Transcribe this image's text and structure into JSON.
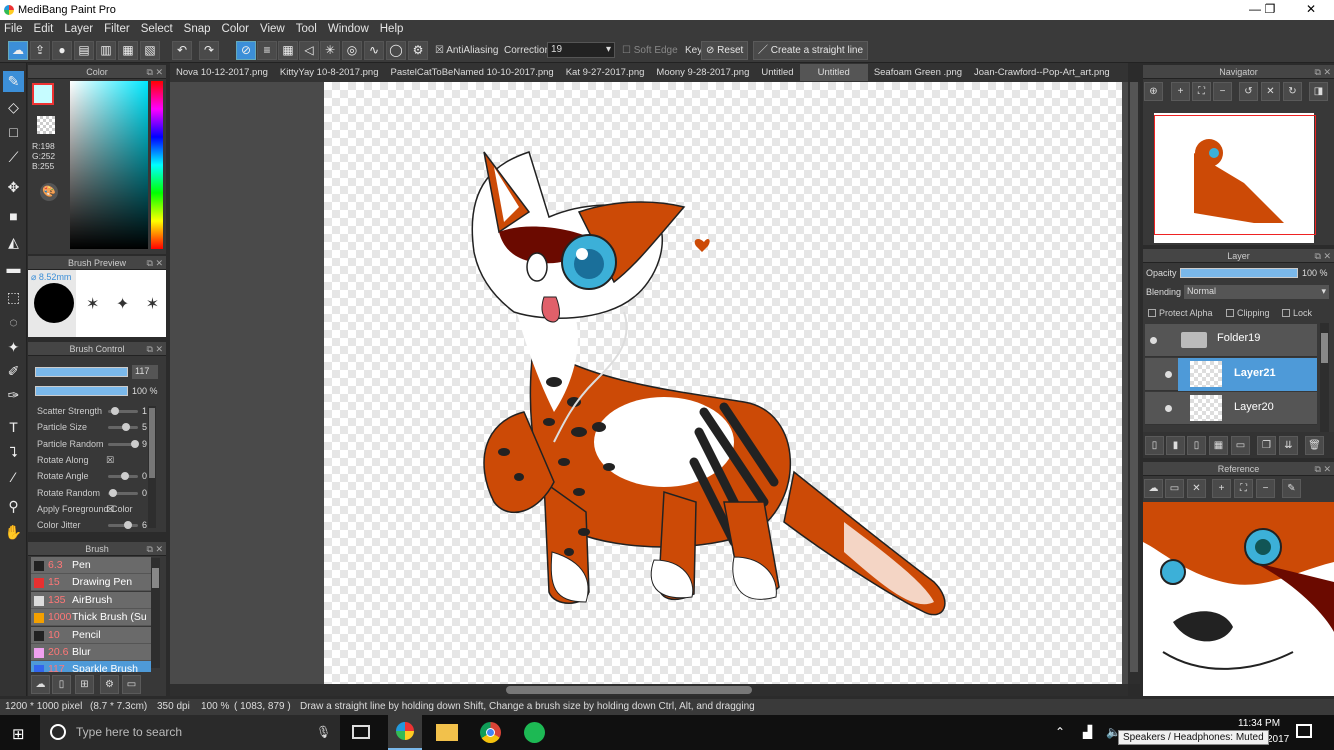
{
  "app": {
    "title": "MediBang Paint Pro",
    "min": "—",
    "max": "❐",
    "close": "✕"
  },
  "menu": [
    "File",
    "Edit",
    "Layer",
    "Filter",
    "Select",
    "Snap",
    "Color",
    "View",
    "Tool",
    "Window",
    "Help"
  ],
  "toolbar": {
    "antialiasing": "AntiAliasing",
    "correction_label": "Correction",
    "correction_value": "19",
    "soft_edge": "Soft Edge",
    "key": "Key",
    "reset": "Reset",
    "straight_line": "Create a straight line"
  },
  "color_panel": {
    "title": "Color",
    "rgb": "R:198\nG:252\nB:255",
    "main_color": "#c6fcff"
  },
  "brush_preview": {
    "title": "Brush Preview",
    "size": "8.52mm"
  },
  "brush_control": {
    "title": "Brush Control",
    "size_value": "117",
    "opacity_value": "100 %",
    "params": [
      {
        "label": "Scatter Strength",
        "value": "1",
        "frac": 0.1
      },
      {
        "label": "Particle Size",
        "value": "5",
        "frac": 0.55
      },
      {
        "label": "Particle Random",
        "value": "9",
        "frac": 0.9
      },
      {
        "label": "Rotate Along",
        "value": "☒"
      },
      {
        "label": "Rotate Angle",
        "value": "0",
        "frac": 0.5
      },
      {
        "label": "Rotate Random",
        "value": "0",
        "frac": 0.05
      },
      {
        "label": "Apply Foreground Color",
        "value": "☒"
      },
      {
        "label": "Color Jitter",
        "value": "6",
        "frac": 0.6
      }
    ]
  },
  "brush_list": {
    "title": "Brush",
    "items": [
      {
        "size": "6.3",
        "name": "Pen",
        "color": "#222222"
      },
      {
        "size": "15",
        "name": "Drawing Pen",
        "color": "#e83030"
      },
      {
        "size": "135",
        "name": "AirBrush",
        "color": "#dddddd"
      },
      {
        "size": "1000",
        "name": "Thick Brush (Su",
        "color": "#f4a000"
      },
      {
        "size": "10",
        "name": "Pencil",
        "color": "#222222"
      },
      {
        "size": "20.6",
        "name": "Blur",
        "color": "#f0a0f0"
      },
      {
        "size": "117",
        "name": "Sparkle Brush",
        "color": "#3366ee"
      }
    ]
  },
  "tabs": [
    "Nova 10-12-2017.png",
    "KittyYay 10-8-2017.png",
    "PastelCatToBeNamed 10-10-2017.png",
    "Kat 9-27-2017.png",
    "Moony 9-28-2017.png",
    "Untitled",
    "Untitled",
    "Seafoam Green .png",
    "Joan-Crawford--Pop-Art_art.png"
  ],
  "active_tab_index": 6,
  "navigator": {
    "title": "Navigator"
  },
  "layer_panel": {
    "title": "Layer",
    "opacity_label": "Opacity",
    "opacity_value": "100 %",
    "blending_label": "Blending",
    "blending_value": "Normal",
    "protect_alpha": "Protect Alpha",
    "clipping": "Clipping",
    "lock": "Lock",
    "layers": [
      {
        "name": "Folder19",
        "type": "folder"
      },
      {
        "name": "Layer21",
        "type": "layer",
        "selected": true
      },
      {
        "name": "Layer20",
        "type": "layer"
      }
    ]
  },
  "reference": {
    "title": "Reference"
  },
  "status": {
    "size": "1200 * 1000 pixel",
    "dims": "(8.7 * 7.3cm)",
    "dpi": "350 dpi",
    "zoom": "100 %",
    "coords": "( 1083, 879 )",
    "hint": "Draw a straight line by holding down Shift, Change a brush size by holding down Ctrl, Alt, and dragging"
  },
  "taskbar": {
    "search": "Type here to search",
    "time": "11:34 PM",
    "date": "2017",
    "tooltip": "Speakers / Headphones: Muted"
  }
}
